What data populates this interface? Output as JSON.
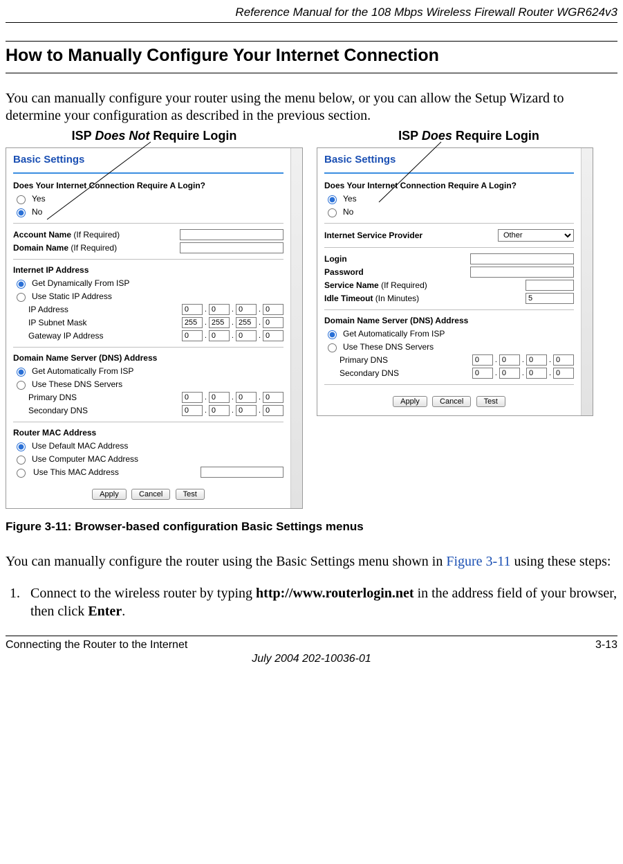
{
  "header": {
    "reference": "Reference Manual for the 108 Mbps Wireless Firewall Router WGR624v3"
  },
  "heading": "How to Manually Configure Your Internet Connection",
  "intro": "You can manually configure your router using the menu below, or you can allow the Setup Wizard to determine your configuration as described in the previous section.",
  "captions": {
    "left_pre": "ISP ",
    "left_em": "Does Not",
    "left_post": " Require Login",
    "right_pre": "ISP ",
    "right_em": "Does",
    "right_post": " Require Login"
  },
  "left_panel": {
    "title": "Basic Settings",
    "login_q": "Does Your Internet Connection Require A Login?",
    "yes": "Yes",
    "no": "No",
    "account_name": "Account Name",
    "if_required": "(If Required)",
    "domain_name": "Domain Name",
    "iip": "Internet IP Address",
    "dyn": "Get Dynamically From ISP",
    "static": "Use Static IP Address",
    "ip_addr": "IP Address",
    "subnet": "IP Subnet Mask",
    "gw": "Gateway IP Address",
    "dns_h": "Domain Name Server (DNS) Address",
    "dns_auto": "Get Automatically From ISP",
    "dns_use": "Use These DNS Servers",
    "pdns": "Primary DNS",
    "sdns": "Secondary DNS",
    "mac_h": "Router MAC Address",
    "mac_def": "Use Default MAC Address",
    "mac_comp": "Use Computer MAC Address",
    "mac_this": "Use This MAC Address",
    "apply": "Apply",
    "cancel": "Cancel",
    "test": "Test",
    "ip": {
      "a": "0",
      "b": "0",
      "c": "0",
      "d": "0"
    },
    "mask": {
      "a": "255",
      "b": "255",
      "c": "255",
      "d": "0"
    },
    "gwip": {
      "a": "0",
      "b": "0",
      "c": "0",
      "d": "0"
    },
    "p": {
      "a": "0",
      "b": "0",
      "c": "0",
      "d": "0"
    },
    "s": {
      "a": "0",
      "b": "0",
      "c": "0",
      "d": "0"
    }
  },
  "right_panel": {
    "title": "Basic Settings",
    "login_q": "Does Your Internet Connection Require A Login?",
    "yes": "Yes",
    "no": "No",
    "isp_label": "Internet Service Provider",
    "isp_value": "Other",
    "login": "Login",
    "password": "Password",
    "service": "Service Name",
    "if_required": "(If Required)",
    "idle": "Idle Timeout",
    "minutes": "(In Minutes)",
    "idle_val": "5",
    "dns_h": "Domain Name Server (DNS) Address",
    "dns_auto": "Get Automatically From ISP",
    "dns_use": "Use These DNS Servers",
    "pdns": "Primary DNS",
    "sdns": "Secondary DNS",
    "apply": "Apply",
    "cancel": "Cancel",
    "test": "Test",
    "p": {
      "a": "0",
      "b": "0",
      "c": "0",
      "d": "0"
    },
    "s": {
      "a": "0",
      "b": "0",
      "c": "0",
      "d": "0"
    }
  },
  "figure_caption": "Figure 3-11:  Browser-based configuration Basic Settings menus",
  "after_figure_pre": "You can manually configure the router using the Basic Settings menu shown in ",
  "after_figure_link": "Figure 3-11",
  "after_figure_post": " using these steps:",
  "step1_pre": "Connect to the wireless router by typing ",
  "step1_url": "http://www.routerlogin.net",
  "step1_mid": " in the address field of your browser, then click ",
  "step1_enter": "Enter",
  "step1_end": ".",
  "footer": {
    "left": "Connecting the Router to the Internet",
    "right": "3-13",
    "date": "July 2004 202-10036-01"
  }
}
